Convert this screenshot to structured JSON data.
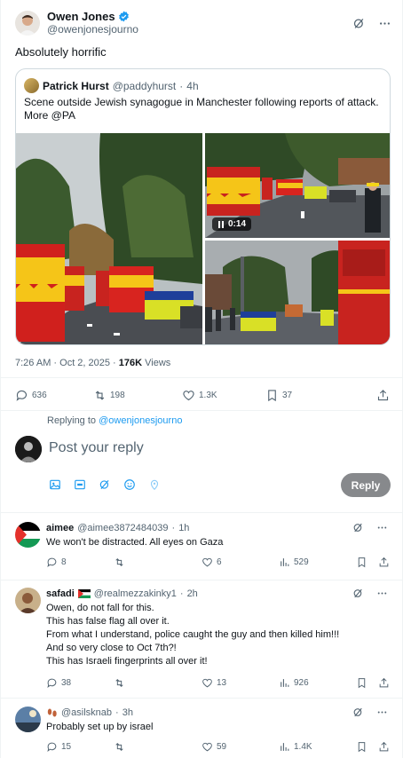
{
  "tweet": {
    "author": "Owen Jones",
    "handle": "@owenjonesjourno",
    "text": "Absolutely horrific",
    "quote": {
      "author": "Patrick Hurst",
      "handle": "@paddyhurst",
      "time": "4h",
      "text": "Scene outside Jewish synagogue in Manchester following reports of attack. More @PA",
      "video_time": "0:14"
    },
    "timestamp": "7:26 AM · Oct 2, 2025 · ",
    "views_count": "176K",
    "views_label": " Views",
    "actions": {
      "replies": "636",
      "reposts": "198",
      "likes": "1.3K",
      "bookmarks": "37"
    }
  },
  "compose": {
    "replying_prefix": "Replying to ",
    "replying_to": "@owenjonesjourno",
    "placeholder": "Post your reply",
    "reply_button": "Reply"
  },
  "replies": [
    {
      "name": "aimee",
      "handle": "@aimee3872484039",
      "time": "1h",
      "lines": [
        "We won't be distracted. All eyes on Gaza"
      ],
      "comments": "8",
      "reposts": "",
      "likes": "6",
      "views": "529"
    },
    {
      "name": "safadi",
      "handle": "@realmezzakinky1",
      "time": "2h",
      "lines": [
        "Owen, do not fall for this.",
        "This has false flag all over it.",
        "From what I understand, police caught the guy and then killed him!!!",
        "And so very close to Oct 7th?!",
        "This has Israeli fingerprints all over it!"
      ],
      "comments": "38",
      "reposts": "",
      "likes": "13",
      "views": "926"
    },
    {
      "name": "",
      "handle": "@asilsknab",
      "time": "3h",
      "lines": [
        "Probably set up by israel"
      ],
      "comments": "15",
      "reposts": "",
      "likes": "59",
      "views": "1.4K"
    }
  ],
  "colors": {
    "accent": "#1d9bf0",
    "muted": "#536471",
    "reply_button": "#87898c",
    "border": "#eff3f4"
  }
}
